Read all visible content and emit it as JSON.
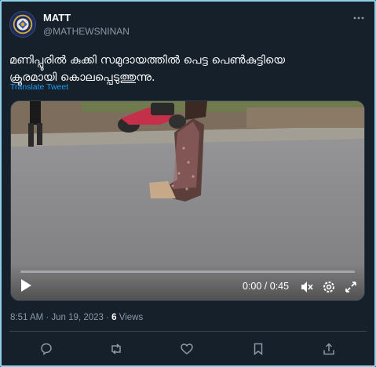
{
  "author": {
    "name": "MATT",
    "handle": "@MATHEWSNINAN"
  },
  "tweet": {
    "text_line1": "മണിപ്പൂരിൽ കുക്കി സമുദായത്തിൽ പെട്ട പെൺകുട്ടിയെ",
    "text_line2": "ക്രൂരമായി കൊലപ്പെടുത്തുന്നു.",
    "translate_label": "Translate Tweet"
  },
  "video": {
    "time_display": "0:00 / 0:45",
    "progress_fraction": 0.0,
    "icons": [
      "play-icon",
      "mute-icon",
      "settings-icon",
      "fullscreen-icon"
    ]
  },
  "meta": {
    "timestamp": "8:51 AM · Jun 19, 2023 · ",
    "views_count": "6",
    "views_label": " Views"
  },
  "actions": [
    "reply-icon",
    "retweet-icon",
    "like-icon",
    "bookmark-icon",
    "share-icon"
  ],
  "colors": {
    "background": "#15202b",
    "link": "#1d9bf0",
    "secondary_text": "#8b98a5",
    "frame_border": "#8ed0e8"
  }
}
